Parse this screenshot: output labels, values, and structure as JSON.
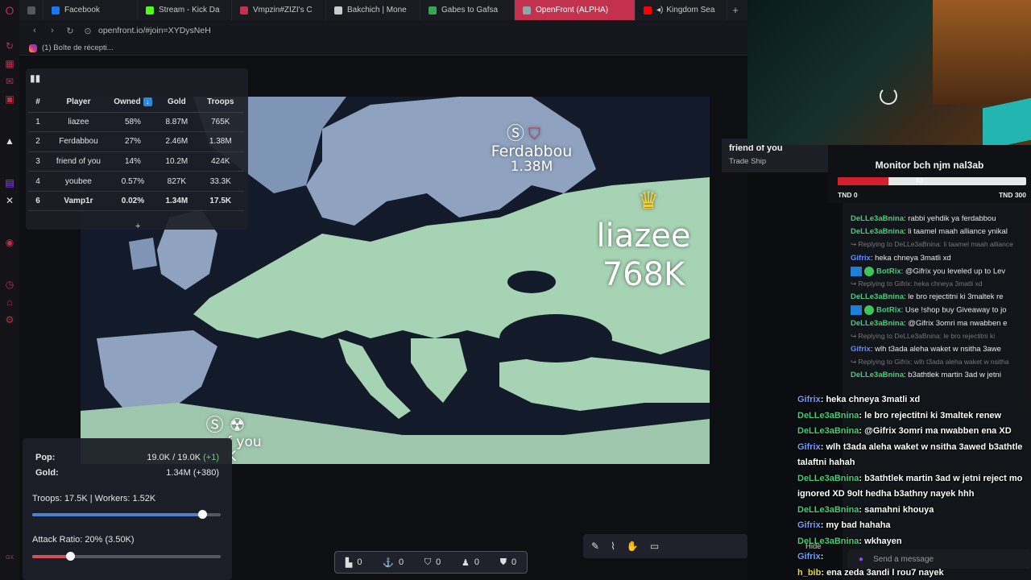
{
  "browser": {
    "tabs": [
      {
        "label": "",
        "color": "#555861"
      },
      {
        "label": "Facebook",
        "color": "#1877f2"
      },
      {
        "label": "Stream - Kick Da",
        "color": "#53fc18"
      },
      {
        "label": "Vmpzin#ZIZI's C",
        "color": "#c2324f"
      },
      {
        "label": "Bakchich | Mone",
        "color": "#cccccc"
      },
      {
        "label": "Gabes to Gafsa",
        "color": "#34a853"
      },
      {
        "label": "OpenFront (ALPHA)",
        "color": "#8aa"
      },
      {
        "label": "Kingdom Sea",
        "color": "#ff0000"
      }
    ],
    "new_tab": "+",
    "url": "openfront.io/#join=XYDysNeH",
    "bookmark": "(1) Boîte de récepti..."
  },
  "game": {
    "leaderboard": {
      "headers": [
        "#",
        "Player",
        "Owned",
        "Gold",
        "Troops"
      ],
      "rows": [
        [
          "1",
          "liazee",
          "58%",
          "8.87M",
          "765K"
        ],
        [
          "2",
          "Ferdabbou",
          "27%",
          "2.46M",
          "1.38M"
        ],
        [
          "3",
          "friend of you",
          "14%",
          "10.2M",
          "424K"
        ],
        [
          "4",
          "youbee",
          "0.57%",
          "827K",
          "33.3K"
        ],
        [
          "6",
          "Vamp1r",
          "0.02%",
          "1.34M",
          "17.5K"
        ]
      ],
      "more": "+"
    },
    "map_labels": {
      "ferdabbou_name": "Ferdabbou",
      "ferdabbou_troops": "1.38M",
      "liazee_name": "liazee",
      "liazee_troops": "768K",
      "friend_partial_1": "f you",
      "friend_partial_2": "K"
    },
    "stats": {
      "pop_label": "Pop:",
      "pop_value": "19.0K / 19.0K",
      "pop_delta": "(+1)",
      "gold_label": "Gold:",
      "gold_value": "1.34M (+380)",
      "troops_label": "Troops: 17.5K | Workers: 1.52K",
      "troops_ratio": 0.9,
      "attack_label": "Attack Ratio: 20% (3.50K)",
      "attack_ratio": 0.2
    },
    "action_bar": [
      "0",
      "0",
      "0",
      "0",
      "0"
    ],
    "tooltip": {
      "title": "friend of you",
      "subtitle": "Trade Ship"
    }
  },
  "stream": {
    "goal": {
      "title": "Monitor bch njm nal3ab",
      "current": "80",
      "fill_fraction": 0.27,
      "min": "TND 0",
      "max": "TND 300"
    },
    "chat_back": [
      {
        "reply": false,
        "user": "DeLLe3aBnina",
        "text": ": rabbi yehdik ya ferdabbou",
        "color": "#3fd17a"
      },
      {
        "reply": false,
        "user": "DeLLe3aBnina",
        "text": ": li taamel maah alliance ynikal",
        "color": "#3fd17a"
      },
      {
        "reply": true,
        "user": "",
        "text": "Replying to DeLLe3aBnina: li taamel maah alliance",
        "color": "#777"
      },
      {
        "reply": false,
        "user": "Gifrix",
        "text": ": heka chneya 3matli xd",
        "color": "#5e8fff"
      },
      {
        "reply": false,
        "user": "BotRix",
        "text": ": @Gifrix you leveled up to Lev",
        "color": "#3fd17a",
        "badge": true
      },
      {
        "reply": true,
        "user": "",
        "text": "Replying to Gifrix: heka chneya 3matli xd",
        "color": "#777"
      },
      {
        "reply": false,
        "user": "DeLLe3aBnina",
        "text": ": le bro rejectitni ki 3maltek re",
        "color": "#3fd17a"
      },
      {
        "reply": false,
        "user": "BotRix",
        "text": ": Use !shop buy Giveaway to jo",
        "color": "#3fd17a",
        "badge": true
      },
      {
        "reply": false,
        "user": "DeLLe3aBnina",
        "text": ": @Gifrix 3omri ma nwabben e",
        "color": "#3fd17a"
      },
      {
        "reply": true,
        "user": "",
        "text": "Replying to DeLLe3aBnina: le bro rejectitni ki",
        "color": "#777"
      },
      {
        "reply": false,
        "user": "Gifrix",
        "text": ": wlh t3ada aleha waket w nsitha 3awe",
        "color": "#5e8fff"
      },
      {
        "reply": true,
        "user": "",
        "text": "Replying to Gifrix: wlh t3ada aleha waket w nsitha",
        "color": "#777"
      },
      {
        "reply": false,
        "user": "DeLLe3aBnina",
        "text": ": b3athtlek martin 3ad w jetni",
        "color": "#3fd17a"
      }
    ],
    "chat_front": [
      {
        "user": "Gifrix",
        "text": ": heka chneya 3matli xd",
        "color": "#6aa0ff"
      },
      {
        "user": "DeLLe3aBnina",
        "text": ": le bro rejectitni ki 3maltek renew",
        "color": "#3fd17a"
      },
      {
        "user": "DeLLe3aBnina",
        "text": ": @Gifrix 3omri ma nwabben ena XD",
        "color": "#3fd17a"
      },
      {
        "user": "Gifrix",
        "text": ": wlh t3ada aleha waket w nsitha 3awed b3athtle",
        "color": "#6aa0ff"
      },
      {
        "user": "",
        "text": "talaftni hahah",
        "color": "#fff"
      },
      {
        "user": "DeLLe3aBnina",
        "text": ": b3athtlek martin 3ad w jetni reject mo",
        "color": "#3fd17a"
      },
      {
        "user": "",
        "text": "ignored XD 9olt hedha b3athny nayek hhh",
        "color": "#fff"
      },
      {
        "user": "DeLLe3aBnina",
        "text": ": samahni khouya",
        "color": "#3fd17a"
      },
      {
        "user": "Gifrix",
        "text": ": my bad hahaha",
        "color": "#6aa0ff"
      },
      {
        "user": "DeLLe3aBnina",
        "text": ": wkhayen",
        "color": "#3fd17a"
      },
      {
        "user": "Gifrix",
        "text": ":",
        "color": "#6aa0ff"
      },
      {
        "user": "h_bib",
        "text": ": ena zeda 3andi l rou7 nayek",
        "color": "#e8d84a"
      }
    ],
    "hide_label": "Hide",
    "send_placeholder": "Send a message"
  }
}
